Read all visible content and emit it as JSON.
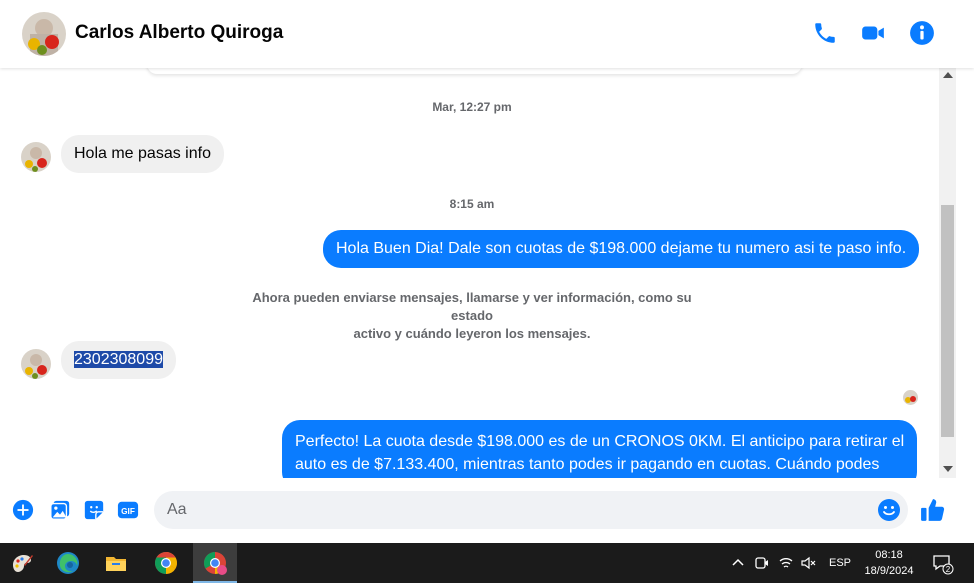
{
  "header": {
    "contact_name": "Carlos Alberto Quiroga",
    "call_icon": "phone-icon",
    "video_icon": "video-camera-icon",
    "info_icon": "info-icon"
  },
  "conversation": {
    "timestamp_1": "Mar, 12:27 pm",
    "msg_in_1": "Hola me pasas info",
    "timestamp_2": "8:15 am",
    "msg_out_1": "Hola Buen Dia! Dale son cuotas de $198.000 dejame tu numero asi te paso info.",
    "system_notice_line1": "Ahora pueden enviarse mensajes, llamarse y ver información, como su estado",
    "system_notice_line2": "activo y cuándo leyeron los mensajes.",
    "msg_in_2": "2302308099",
    "msg_out_2_line1": "Perfecto! La cuota desde $198.000 es de un CRONOS 0KM. El anticipo para retirar el",
    "msg_out_2_line2": "auto es de $7.133.400, mientras tanto podes ir pagando en cuotas. Cuándo podes"
  },
  "composer": {
    "placeholder": "Aa",
    "icons": [
      "plus-circle-icon",
      "image-icon",
      "sticker-icon",
      "gif-icon",
      "emoji-icon",
      "thumbs-up-icon"
    ],
    "gif_label": "GIF"
  },
  "colors": {
    "accent": "#0a7cff",
    "incoming_bubble": "#f0f0f0",
    "taskbar": "#1b1b1b"
  },
  "taskbar": {
    "apps": [
      "paint-icon",
      "edge-icon",
      "file-explorer-icon",
      "chrome-icon",
      "chrome-profile-icon"
    ],
    "language": "ESP",
    "time": "08:18",
    "date": "18/9/2024",
    "notification_count": "2"
  }
}
